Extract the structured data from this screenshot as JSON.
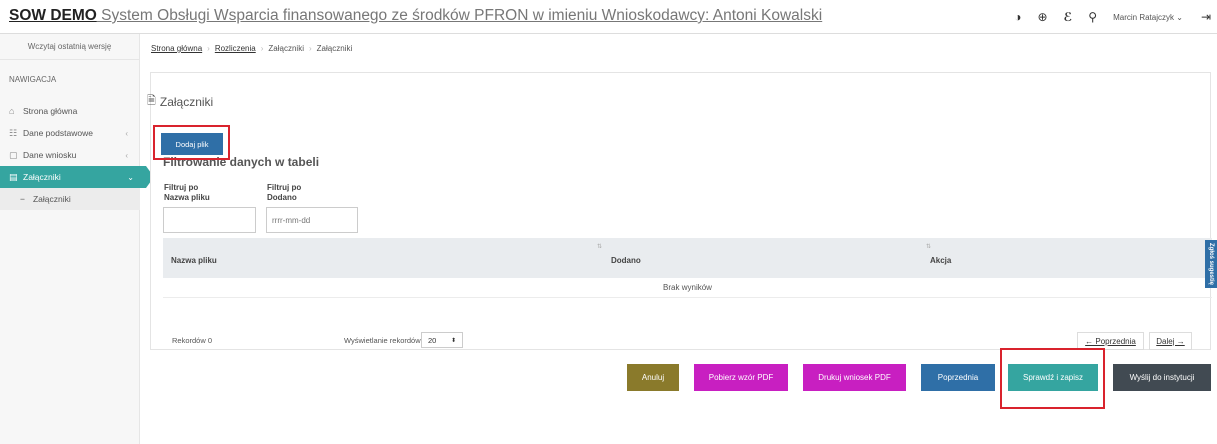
{
  "header": {
    "brand": "SOW DEMO",
    "title_rest": " System Obsługi Wsparcia finansowanego ze środków PFRON w imieniu Wnioskodawcy: Antoni Kowalski",
    "user": "Marcin Ratajczyk",
    "icons": [
      "contrast-icon",
      "zoom-icon",
      "sign-language-icon",
      "wrench-icon",
      "logout-icon"
    ]
  },
  "sidebar": {
    "version_label": "Wczytaj ostatnią wersję",
    "nav_heading": "NAWIGACJA",
    "items": [
      {
        "label": "Strona główna",
        "icon": "home-icon"
      },
      {
        "label": "Dane podstawowe",
        "icon": "users-icon"
      },
      {
        "label": "Dane wniosku",
        "icon": "document-icon"
      },
      {
        "label": "Załączniki",
        "icon": "attachment-icon"
      }
    ],
    "sub_item": "Załączniki"
  },
  "breadcrumb": {
    "home": "Strona główna",
    "settlements": "Rozliczenia",
    "attachments1": "Załączniki",
    "attachments2": "Załączniki"
  },
  "main": {
    "title": "Załączniki",
    "add_button": "Dodaj plik",
    "filter_heading": "Filtrowanie danych w tabeli",
    "filter_filename_label_1": "Filtruj po",
    "filter_filename_label_2": "Nazwa pliku",
    "filter_date_label_1": "Filtruj po",
    "filter_date_label_2": "Dodano",
    "date_placeholder": "rrrr-mm-dd",
    "columns": [
      "Nazwa pliku",
      "Dodano",
      "Akcja"
    ],
    "sort_glyph": "⇅",
    "empty_message": "Brak wyników",
    "record_count": "Rekordów 0",
    "showing_label": "Wyświetlanie rekordów",
    "page_size": "20",
    "prev_page": "← Poprzednia",
    "next_page": "Dalej →",
    "side_tab": "Zgłoś sugestię"
  },
  "actions": {
    "cancel": "Anuluj",
    "download_template": "Pobierz wzór PDF",
    "print_pdf": "Drukuj wniosek PDF",
    "previous": "Poprzednia",
    "check_save": "Sprawdź i zapisz",
    "send": "Wyślij do instytucji"
  },
  "colors": {
    "accent": "#35a5a0",
    "primary_blue": "#2f6fa7",
    "highlight_red": "#d9232d",
    "cancel": "#8a7a2b",
    "magenta": "#c81fc1",
    "dark": "#414a52"
  }
}
